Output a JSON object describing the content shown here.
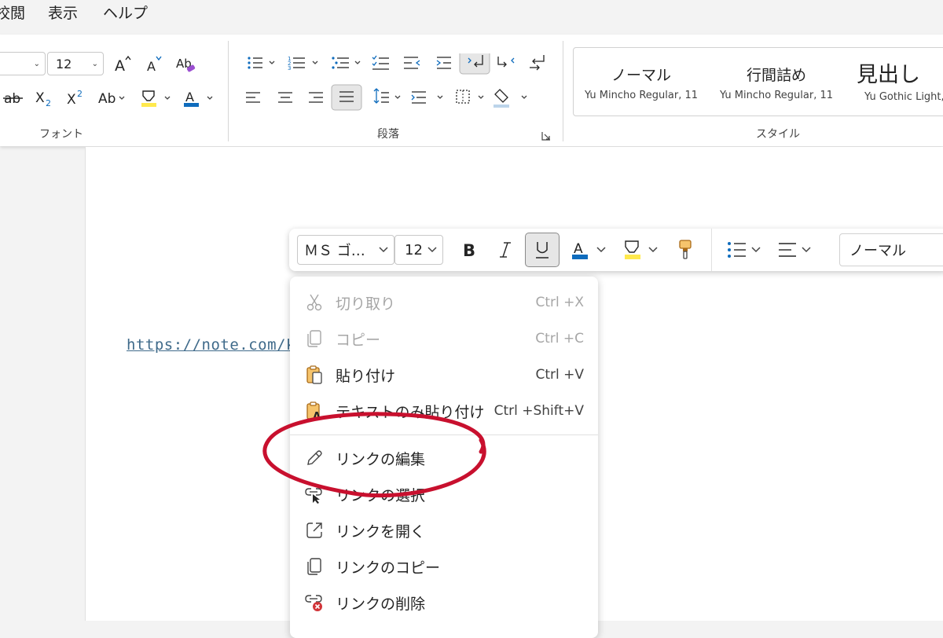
{
  "menubar": {
    "items": [
      "校閲",
      "表示",
      "ヘルプ"
    ]
  },
  "ribbon": {
    "font": {
      "size": "12",
      "label": "フォント"
    },
    "paragraph": {
      "label": "段落"
    },
    "styles": {
      "label": "スタイル",
      "cards": [
        {
          "name": "ノーマル",
          "font": "Yu Mincho Regular, 11"
        },
        {
          "name": "行間詰め",
          "font": "Yu Mincho Regular, 11"
        },
        {
          "name": "見出し",
          "font": "Yu Gothic Light,"
        }
      ]
    }
  },
  "document": {
    "link_text": "https://note.com/k"
  },
  "mini_toolbar": {
    "font_name": "ＭＳ ゴ…",
    "font_size": "12",
    "style": "ノーマル"
  },
  "context_menu": {
    "items": [
      {
        "label": "切り取り",
        "shortcut": "Ctrl +X",
        "icon": "scissors-icon",
        "disabled": true
      },
      {
        "label": "コピー",
        "shortcut": "Ctrl +C",
        "icon": "copy-icon",
        "disabled": true
      },
      {
        "label": "貼り付け",
        "shortcut": "Ctrl +V",
        "icon": "paste-icon",
        "disabled": false
      },
      {
        "label": "テキストのみ貼り付け",
        "shortcut": "Ctrl +Shift+V",
        "icon": "paste-text-icon",
        "disabled": false
      },
      {
        "label": "リンクの編集",
        "shortcut": "",
        "icon": "pencil-icon",
        "disabled": false
      },
      {
        "label": "リンクの選択",
        "shortcut": "",
        "icon": "link-select-icon",
        "disabled": false
      },
      {
        "label": "リンクを開く",
        "shortcut": "",
        "icon": "open-link-icon",
        "disabled": false
      },
      {
        "label": "リンクのコピー",
        "shortcut": "",
        "icon": "copy-link-icon",
        "disabled": false
      },
      {
        "label": "リンクの削除",
        "shortcut": "",
        "icon": "remove-link-icon",
        "disabled": false
      }
    ]
  },
  "colors": {
    "accent": "#0f6cbd",
    "highlight": "#ffe94d",
    "annotation": "#c8102e",
    "link": "#3f6a8a"
  }
}
